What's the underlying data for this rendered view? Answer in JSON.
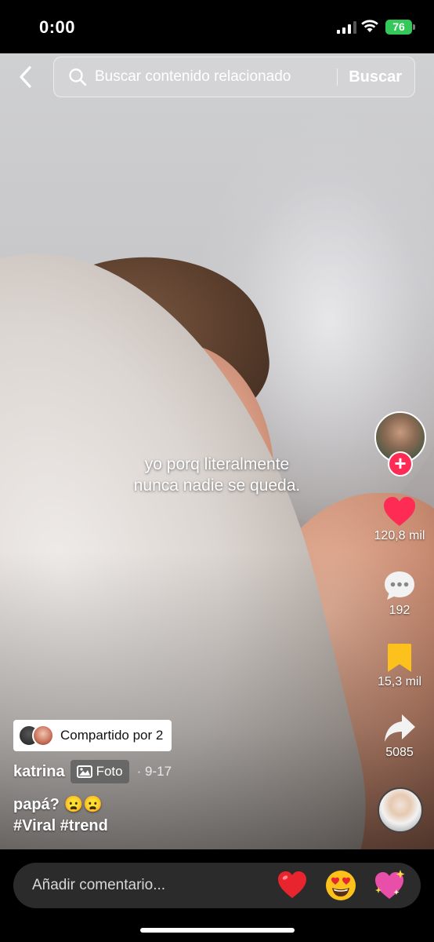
{
  "status_bar": {
    "time": "0:00",
    "battery": "76"
  },
  "search": {
    "placeholder": "Buscar contenido relacionado",
    "button_label": "Buscar"
  },
  "post": {
    "overlay_line1": "yo porq literalmente",
    "overlay_line2": "nunca nadie se queda.",
    "shared_label": "Compartido por 2",
    "username": "katrina",
    "type_badge": "Foto",
    "date": "· 9-17",
    "caption": "papá? 😦😦",
    "hashtags": "#Viral #trend"
  },
  "actions": {
    "likes": "120,8 mil",
    "comments": "192",
    "saves": "15,3 mil",
    "shares": "5085"
  },
  "comment_bar": {
    "placeholder": "Añadir comentario...",
    "emojis": [
      "❤️",
      "😍",
      "💖"
    ]
  },
  "colors": {
    "like": "#fe2c55",
    "save": "#fcc11c",
    "battery": "#34c759"
  }
}
